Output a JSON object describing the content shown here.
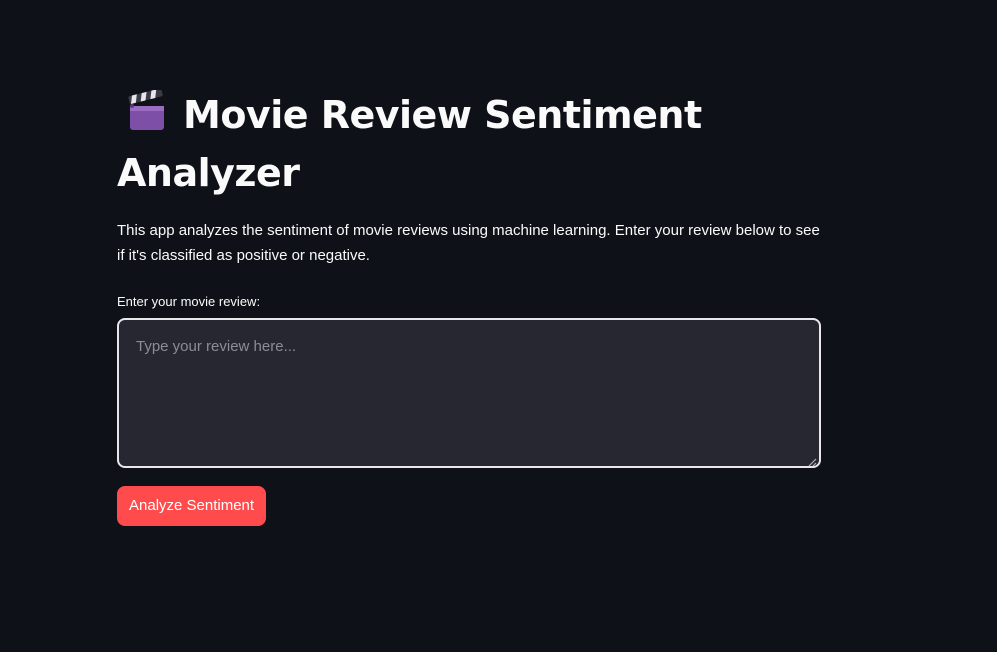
{
  "header": {
    "title_icon": "clapperboard-icon",
    "title": "Movie Review Sentiment Analyzer"
  },
  "description": "This app analyzes the sentiment of movie reviews using machine learning. Enter your review below to see if it's classified as positive or negative.",
  "review_input": {
    "label": "Enter your movie review:",
    "placeholder": "Type your review here...",
    "value": ""
  },
  "analyze_button": {
    "label": "Analyze Sentiment"
  },
  "colors": {
    "background": "#0e1117",
    "text": "#fafafa",
    "input_background": "#262730",
    "button": "#ff4b4b"
  }
}
